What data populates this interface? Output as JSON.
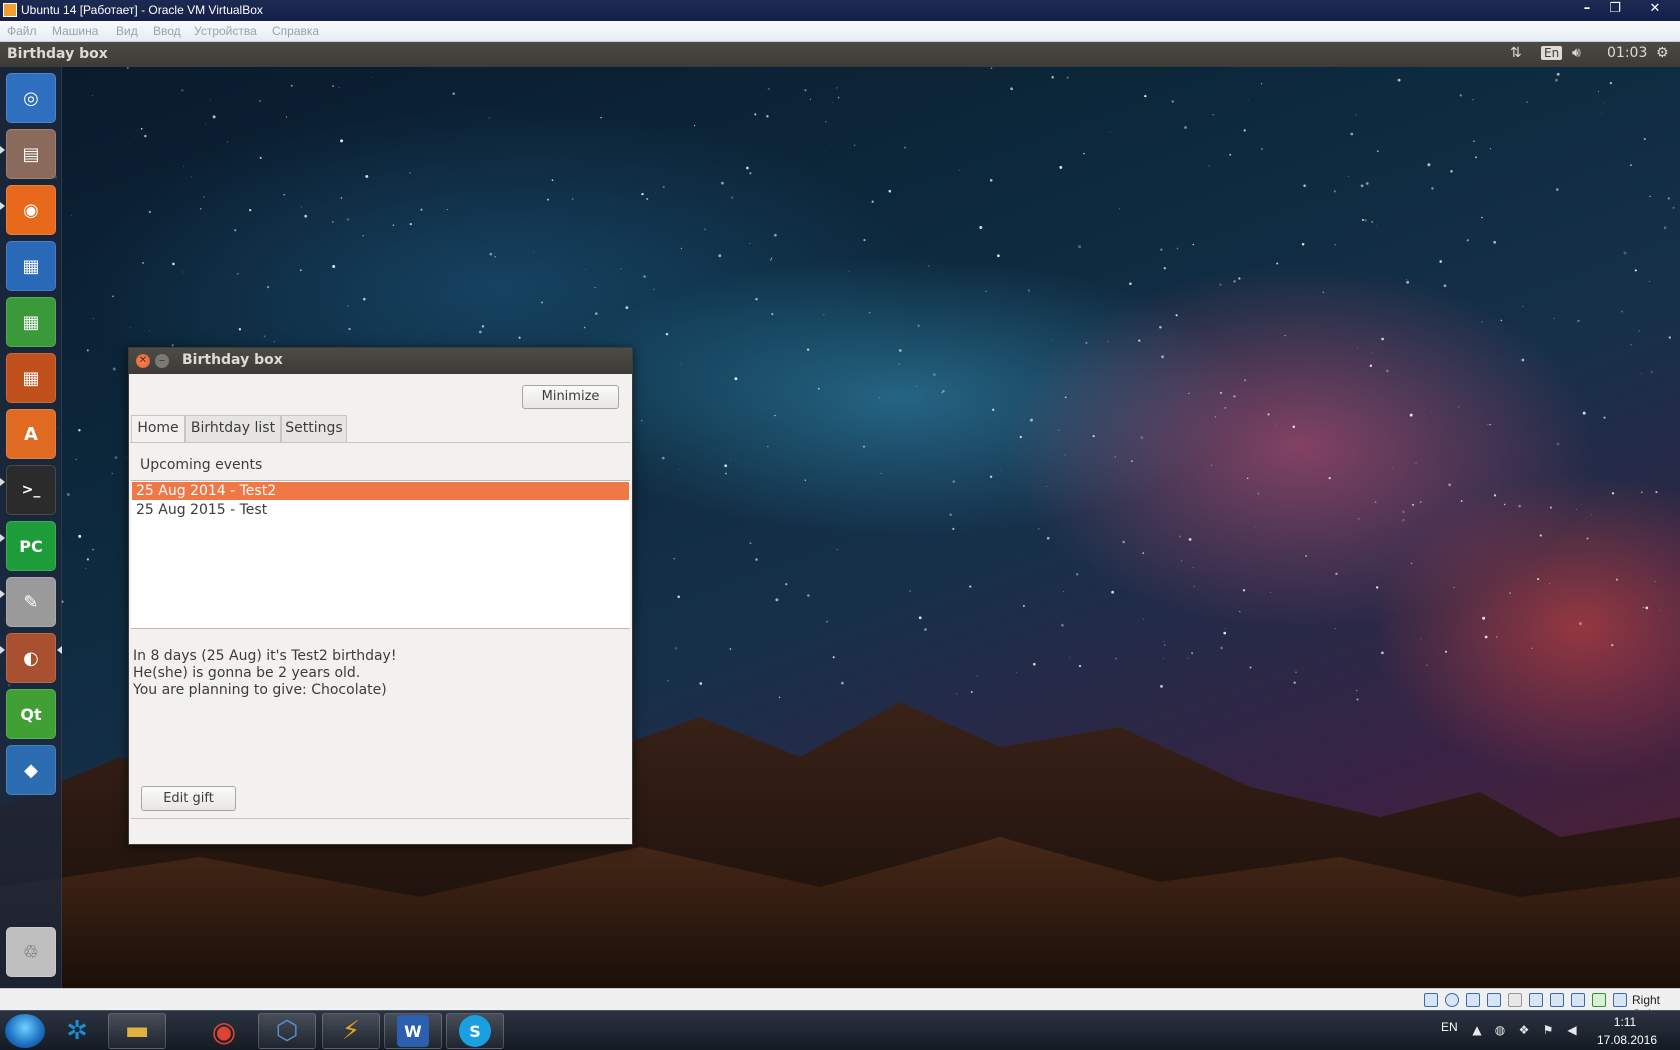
{
  "host_window": {
    "title": "Ubuntu 14 [Работает] - Oracle VM VirtualBox",
    "controls": [
      "–",
      "❐",
      "✕"
    ]
  },
  "vbox_menu": [
    "Файл",
    "Машина",
    "Вид",
    "Ввод",
    "Устройства",
    "Справка"
  ],
  "ubuntu_panel": {
    "app_title": "Birthday box",
    "keyboard_layout": "En",
    "clock": "01:03"
  },
  "launcher": {
    "items": [
      {
        "name": "ubuntu-dash-icon",
        "color": "#2f6fc0",
        "glyph": "◎"
      },
      {
        "name": "files-icon",
        "color": "#8a6a5a",
        "glyph": "▤"
      },
      {
        "name": "firefox-icon",
        "color": "#e8691c",
        "glyph": "◉"
      },
      {
        "name": "libreoffice-writer-icon",
        "color": "#2a68b8",
        "glyph": "▦"
      },
      {
        "name": "libreoffice-calc-icon",
        "color": "#3a9a3a",
        "glyph": "▦"
      },
      {
        "name": "libreoffice-impress-icon",
        "color": "#c0501c",
        "glyph": "▦"
      },
      {
        "name": "software-center-icon",
        "color": "#e06a22",
        "glyph": "A"
      },
      {
        "name": "terminal-icon",
        "color": "#2b2b2b",
        "glyph": ">_"
      },
      {
        "name": "pycharm-icon",
        "color": "#1e9e3a",
        "glyph": "PC"
      },
      {
        "name": "text-editor-icon",
        "color": "#9a9a9a",
        "glyph": "✎"
      },
      {
        "name": "birthday-box-icon",
        "color": "#a85030",
        "glyph": "◐"
      },
      {
        "name": "qt-creator-icon",
        "color": "#41a033",
        "glyph": "Qt"
      },
      {
        "name": "fish-app-icon",
        "color": "#2c6cb0",
        "glyph": "◆"
      }
    ],
    "trash": {
      "name": "trash-icon",
      "color": "#bfbfbf",
      "glyph": "♲"
    }
  },
  "app_window": {
    "title": "Birthday box",
    "minimize_button": "Minimize",
    "tabs": [
      {
        "label": "Home",
        "active": true
      },
      {
        "label": "Birhtday list",
        "active": false
      },
      {
        "label": "Settings",
        "active": false
      }
    ],
    "upcoming_label": "Upcoming events",
    "events": [
      {
        "text": "25 Aug 2014  -  Test2",
        "selected": true
      },
      {
        "text": "25 Aug 2015  -  Test",
        "selected": false
      }
    ],
    "details": [
      "In 8 days (25 Aug) it's Test2 birthday!",
      "He(she) is gonna be 2 years old.",
      "You are planning to give: Chocolate)"
    ],
    "edit_gift_button": "Edit gift",
    "accent_color": "#f07746"
  },
  "vbox_status": {
    "host_key": "Right Ctrl"
  },
  "win_taskbar": {
    "pinned": [
      {
        "name": "network-app-icon",
        "glyph": "✲",
        "color": "#1a8fd8"
      },
      {
        "name": "explorer-icon",
        "glyph": "▬",
        "color": "#e0b040"
      },
      {
        "name": "chrome-icon",
        "glyph": "◉",
        "color": "#dd4433"
      },
      {
        "name": "virtualbox-icon",
        "glyph": "⬡",
        "color": "#5a8fcf"
      },
      {
        "name": "winamp-icon",
        "glyph": "⚡",
        "color": "#e0a020"
      },
      {
        "name": "word-icon",
        "glyph": "W",
        "color": "#2b5fb0"
      },
      {
        "name": "skype-icon",
        "glyph": "S",
        "color": "#1a9fe0"
      }
    ],
    "tray": {
      "language": "EN",
      "time": "1:11",
      "date": "17.08.2016"
    }
  }
}
